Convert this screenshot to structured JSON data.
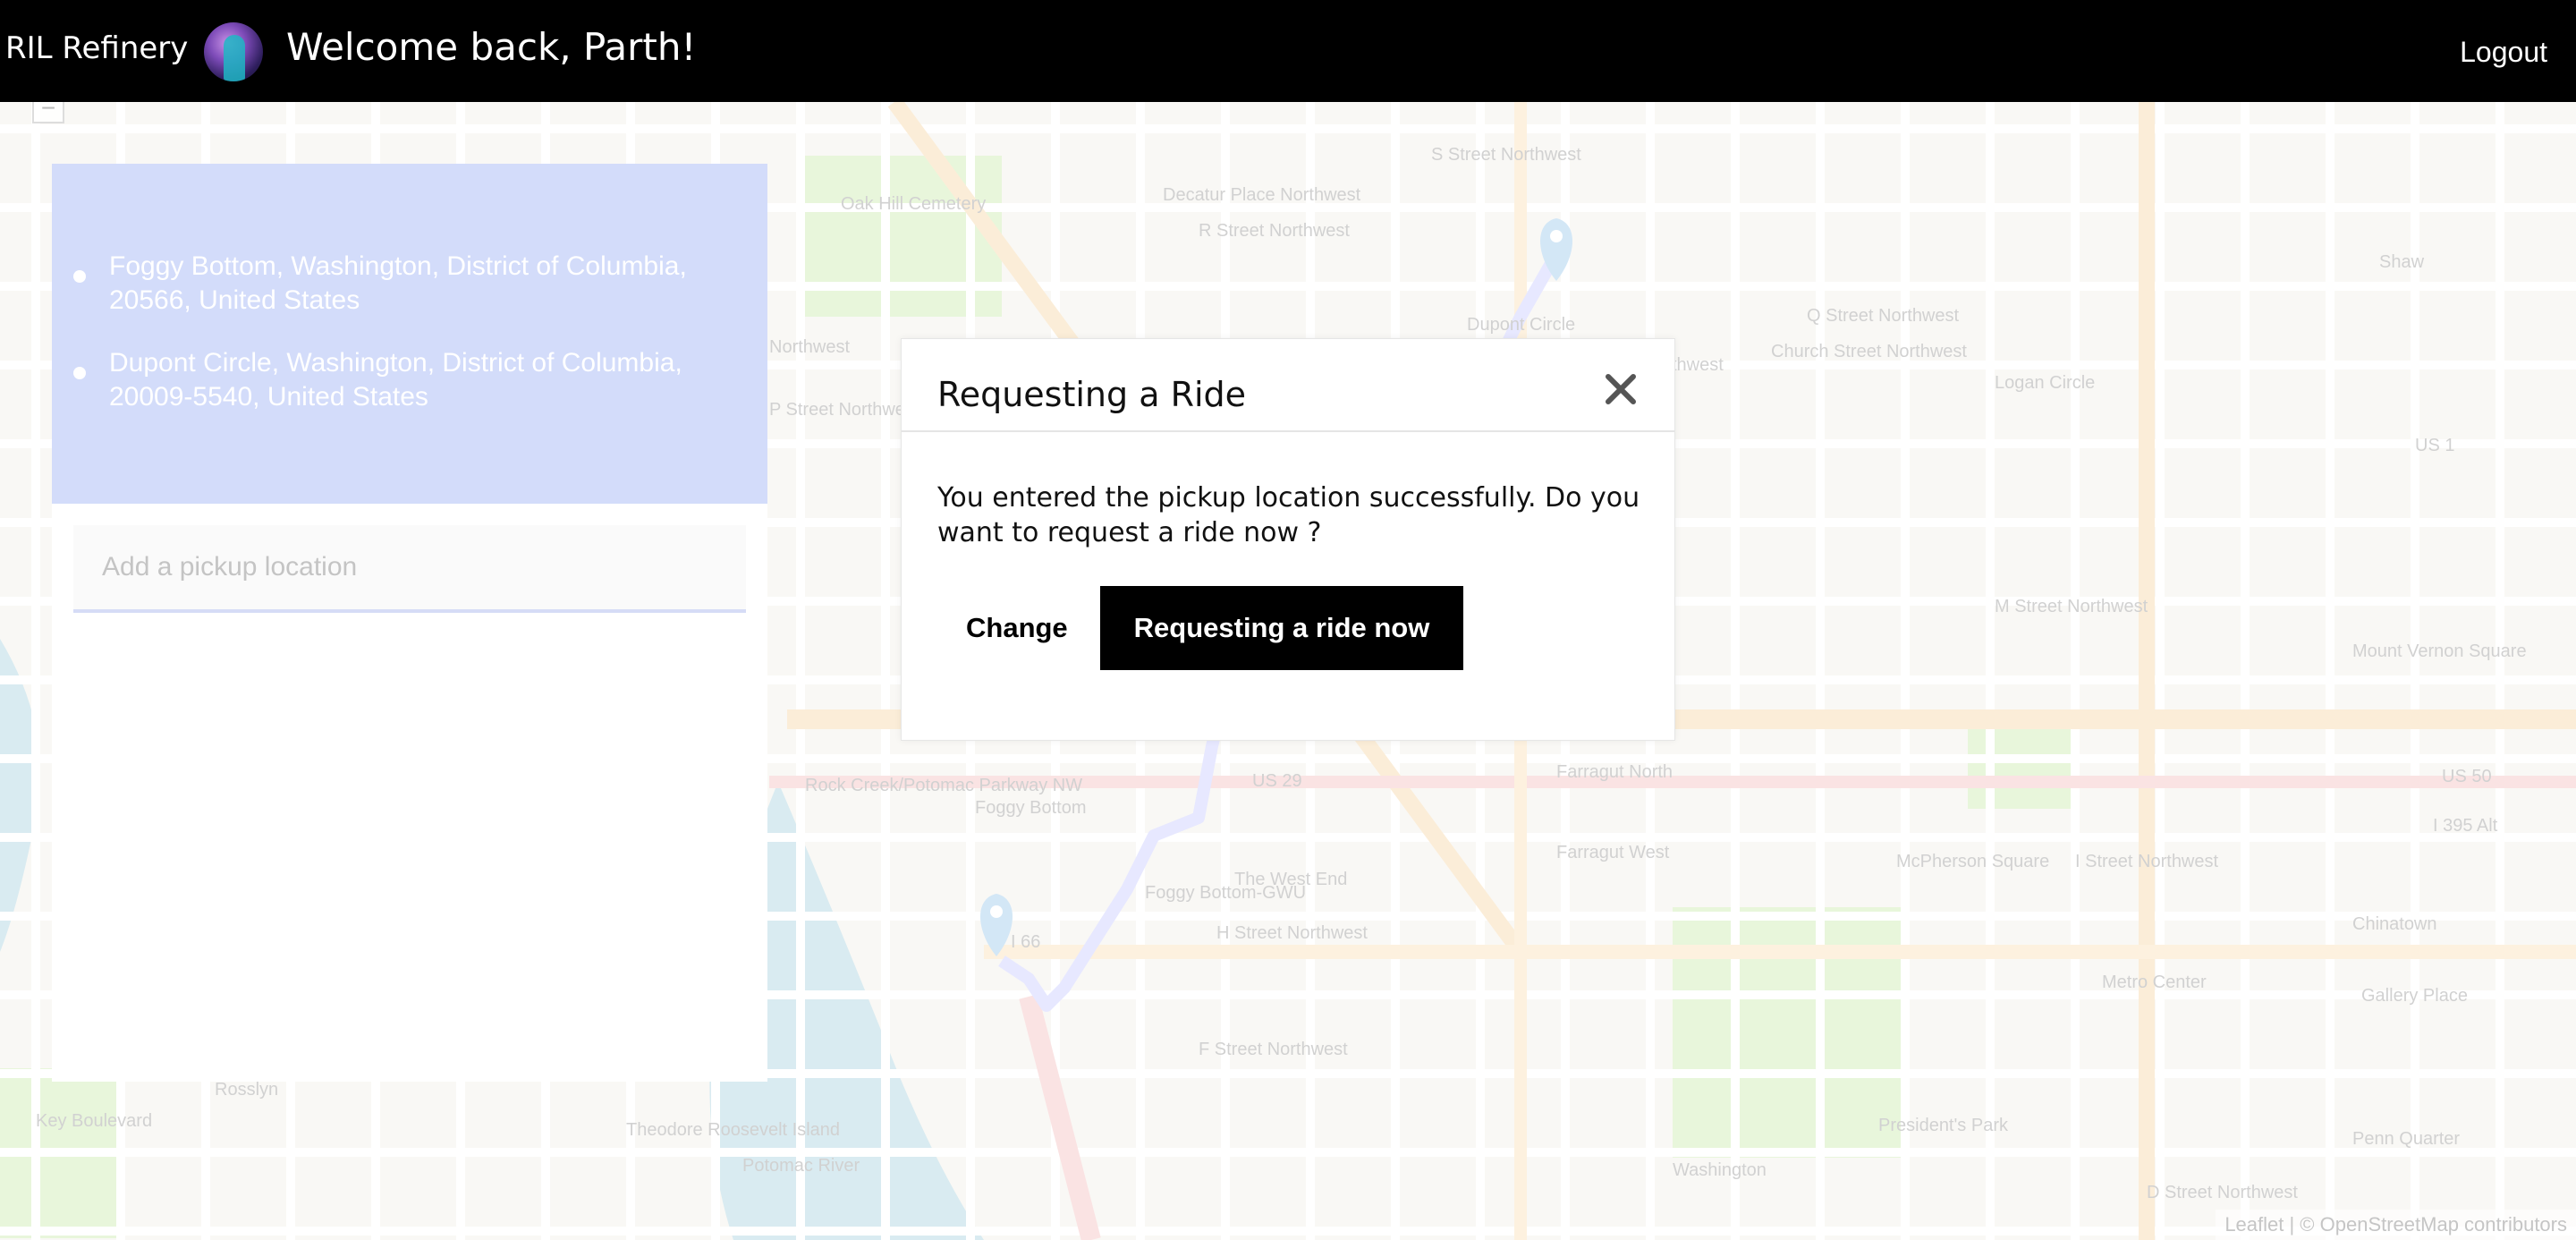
{
  "header": {
    "brand": "RIL Refinery",
    "welcome": "Welcome back, Parth!",
    "logout_label": "Logout"
  },
  "panel": {
    "locations": [
      {
        "address": "Foggy Bottom, Washington, District of Columbia, 20566, United States"
      },
      {
        "address": "Dupont Circle, Washington, District of Columbia, 20009-5540, United States"
      }
    ],
    "pickup_placeholder": "Add a pickup location",
    "accent_color": "#d3dcfa"
  },
  "map": {
    "zoom_out_label": "−",
    "attribution": "Leaflet | © OpenStreetMap contributors",
    "labels": [
      "Oak Hill Cemetery",
      "R Street Northwest",
      "Decatur Place Northwest",
      "S Street Northwest",
      "Dupont Circle",
      "Corcoran Street Northwest",
      "Q Street Northwest",
      "Church Street Northwest",
      "Logan Circle",
      "Shaw",
      "P Street Northwest",
      "Northwest",
      "M Street Northwest",
      "Rock Creek/Potomac Parkway NW",
      "Foggy Bottom",
      "Foggy Bottom-GWU",
      "The West End",
      "H Street Northwest",
      "Farragut North",
      "Farragut West",
      "McPherson Square",
      "I Street Northwest",
      "Chinatown",
      "Gallery Place",
      "Mount Vernon Square",
      "Metro Center",
      "F Street Northwest",
      "President's Park",
      "Washington",
      "Penn Quarter",
      "D Street Northwest",
      "Rosslyn",
      "Key Boulevard",
      "Theodore Roosevelt Island",
      "Potomac River",
      "US 29",
      "US 1",
      "US 50",
      "I 395 Alt",
      "I 66"
    ],
    "route_color": "#c9ccff"
  },
  "modal": {
    "title": "Requesting a Ride",
    "message": "You entered the pickup location successfully. Do you want to request a ride now ?",
    "change_label": "Change",
    "request_label": "Requesting a ride now",
    "close_icon": "close-icon"
  }
}
